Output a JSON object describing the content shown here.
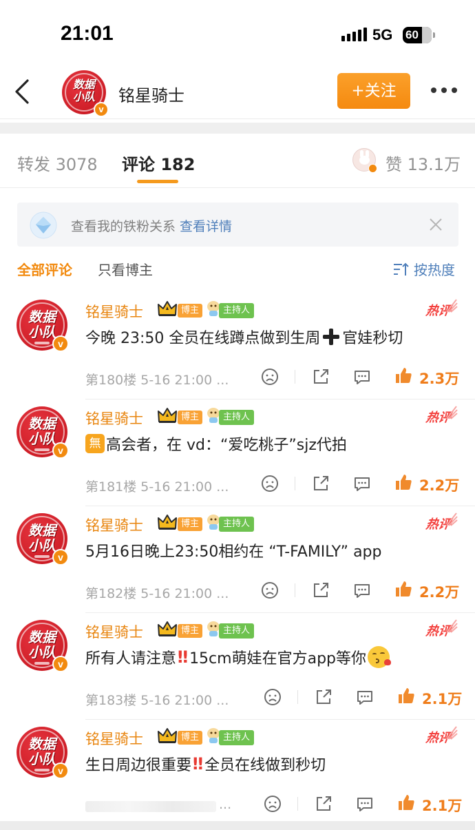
{
  "status_bar": {
    "time": "21:01",
    "network": "5G",
    "battery": "60"
  },
  "header": {
    "username": "铭星骑士",
    "follow_label": "+关注",
    "avatar_line1": "数据",
    "avatar_line2": "小队"
  },
  "tabs": {
    "repost": "转发 3078",
    "comments": "评论 182",
    "likes": "赞 13.1万"
  },
  "fan_banner": {
    "text": "查看我的铁粉关系",
    "link": "查看详情"
  },
  "filter": {
    "all": "全部评论",
    "author_only": "只看博主",
    "sort": "按热度"
  },
  "comments": [
    {
      "name": "铭星骑士",
      "badge_author": "博主",
      "badge_host": "主持人",
      "hot": "热评",
      "text_a": "今晚 23:50 全员在线蹲点做到生周",
      "text_b": "官娃秒切",
      "meta": "第180楼 5-16 21:00 ...",
      "likes": "2.3万"
    },
    {
      "name": "铭星骑士",
      "badge_author": "博主",
      "badge_host": "主持人",
      "hot": "热评",
      "wu": "無",
      "text_a": "高会者，在 vd：“爱吃桃子”sjz代拍",
      "meta": "第181楼 5-16 21:00 ...",
      "likes": "2.2万"
    },
    {
      "name": "铭星骑士",
      "badge_author": "博主",
      "badge_host": "主持人",
      "hot": "热评",
      "text_a": "5月16日晚上23:50相约在 “T-FAMILY” app",
      "meta": "第182楼 5-16 21:00 ...",
      "likes": "2.2万"
    },
    {
      "name": "铭星骑士",
      "badge_author": "博主",
      "badge_host": "主持人",
      "hot": "热评",
      "text_a": "所有人请注意",
      "text_b": "15cm萌娃在官方app等你",
      "meta": "第183楼 5-16 21:00 ...",
      "likes": "2.1万"
    },
    {
      "name": "铭星骑士",
      "badge_author": "博主",
      "badge_host": "主持人",
      "hot": "热评",
      "text_a": "生日周边很重要",
      "text_b": "全员在线做到秒切",
      "meta": "...",
      "likes": "2.1万"
    }
  ],
  "icons": [
    "back-arrow-icon",
    "more-icon",
    "crown-icon",
    "pill-icon",
    "hot-comment-icon",
    "dislike-icon",
    "share-icon",
    "reply-icon",
    "thumbs-up-icon",
    "close-icon",
    "sort-icon"
  ],
  "colors": {
    "accent": "#f28a0f",
    "link": "#4f7fba",
    "hot_red": "#f33f3c",
    "host_green": "#6ec24f"
  }
}
